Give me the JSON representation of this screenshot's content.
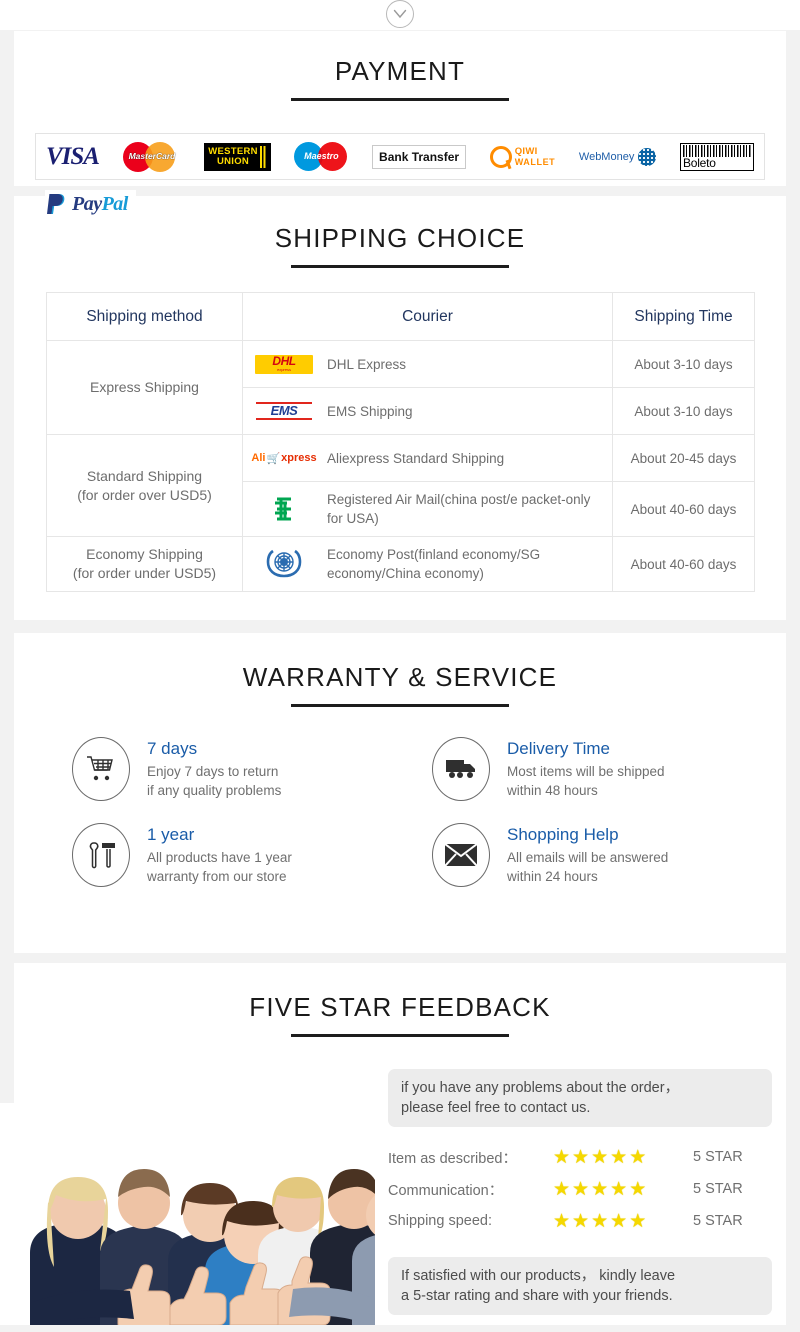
{
  "top": {
    "chevron_icon": "chevron-down-icon"
  },
  "payment": {
    "title": "PAYMENT",
    "methods": [
      {
        "name": "visa",
        "label": "VISA"
      },
      {
        "name": "mastercard",
        "label": "MasterCard"
      },
      {
        "name": "western-union",
        "line1": "WESTERN",
        "line2": "UNION"
      },
      {
        "name": "maestro",
        "label": "Maestro"
      },
      {
        "name": "bank-transfer",
        "label": "Bank Transfer"
      },
      {
        "name": "qiwi-wallet",
        "line1": "QIWI",
        "line2": "WALLET"
      },
      {
        "name": "webmoney",
        "label": "WebMoney"
      },
      {
        "name": "boleto",
        "label": "Boleto"
      }
    ],
    "paypal": {
      "part1": "Pay",
      "part2": "Pal"
    }
  },
  "shipping": {
    "title": "SHIPPING CHOICE",
    "columns": [
      "Shipping method",
      "Courier",
      "Shipping Time"
    ],
    "rows": [
      {
        "method": "Express Shipping",
        "method_rowspan": 2,
        "logo": "dhl-logo",
        "courier": "DHL Express",
        "time": "About 3-10 days"
      },
      {
        "method": null,
        "logo": "ems-logo",
        "courier": "EMS Shipping",
        "time": "About 3-10 days"
      },
      {
        "method": "Standard Shipping\n(for order over USD5)",
        "method_rowspan": 2,
        "logo": "aliexpress-logo",
        "courier": "Aliexpress Standard Shipping",
        "time": "About 20-45 days"
      },
      {
        "method": null,
        "logo": "china-post-logo",
        "courier": "Registered Air Mail(china post/e packet-only for USA)",
        "time": "About 40-60 days"
      },
      {
        "method": "Economy Shipping\n(for order under USD5)",
        "method_rowspan": 1,
        "logo": "un-logo",
        "courier": "Economy Post(finland economy/SG economy/China economy)",
        "time": "About 40-60 days"
      }
    ]
  },
  "warranty": {
    "title": "WARRANTY & SERVICE",
    "items": [
      {
        "icon": "shopping-cart-icon",
        "heading": "7 days",
        "line1": "Enjoy 7 days to return",
        "line2": "if any quality problems"
      },
      {
        "icon": "delivery-truck-icon",
        "heading": "Delivery Time",
        "line1": "Most items will be shipped",
        "line2": "within 48 hours"
      },
      {
        "icon": "tools-icon",
        "heading": "1 year",
        "line1": "All products have 1 year",
        "line2": "warranty from our store"
      },
      {
        "icon": "envelope-icon",
        "heading": "Shopping Help",
        "line1": "All emails will be answered",
        "line2": "within 24 hours"
      }
    ]
  },
  "feedback": {
    "title": "FIVE STAR FEEDBACK",
    "photo_alt": "happy-business-team-thumbs-up",
    "bubble_top_line1": "if you have any problems about the order，",
    "bubble_top_line2": "please feel free to contact us.",
    "ratings": [
      {
        "label": "Item as described：",
        "stars": 5,
        "value": "5 STAR"
      },
      {
        "label": "Communication：",
        "stars": 5,
        "value": "5 STAR"
      },
      {
        "label": "Shipping speed:",
        "stars": 5,
        "value": "5 STAR"
      }
    ],
    "bubble_bottom_line1": "If satisfied with our products， kindly leave",
    "bubble_bottom_line2": "a 5-star rating and share with your friends."
  },
  "colors": {
    "page_bg": "#f2f2f2",
    "card_bg": "#ffffff",
    "title": "#1a1a1a",
    "table_header": "#22365f",
    "body_text": "#6d6d6d",
    "accent_blue": "#1a5ca8",
    "star_yellow": "#f5d800",
    "bubble_bg": "#ececec"
  }
}
